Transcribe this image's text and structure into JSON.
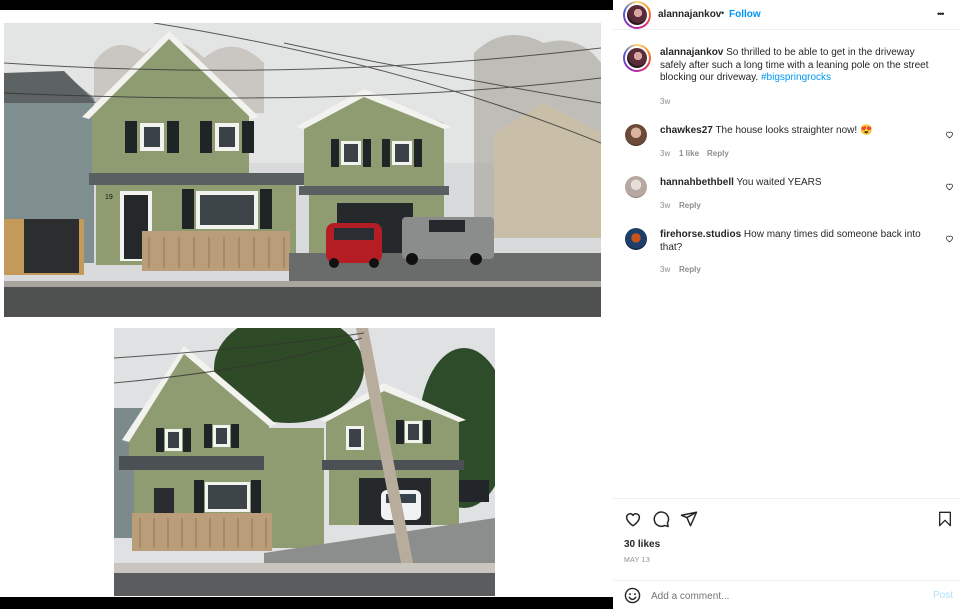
{
  "post": {
    "author": "alannajankov",
    "follow_label": "Follow",
    "separator": "•",
    "more_label": "•••",
    "caption_text": "So thrilled to be able to get in the driveway safely after such a long time with a leaning pole on the street blocking our driveway.",
    "hashtag": "#bigspringrocks",
    "caption_age": "3w",
    "likes": "30 likes",
    "date": "MAY 13",
    "add_comment_placeholder": "Add a comment...",
    "post_button": "Post",
    "house_number": "19"
  },
  "comments": [
    {
      "user": "chawkes27",
      "text": "The house looks straighter now! 😍",
      "age": "3w",
      "likes": "1 like",
      "reply": "Reply"
    },
    {
      "user": "hannahbethbell",
      "text": "You waited YEARS",
      "age": "3w",
      "likes": "",
      "reply": "Reply"
    },
    {
      "user": "firehorse.studios",
      "text": "How many times did someone back into that?",
      "age": "3w",
      "likes": "",
      "reply": "Reply"
    }
  ],
  "icons": {
    "like": "heart-icon",
    "comment": "comment-bubble-icon",
    "share": "paper-plane-icon",
    "save": "bookmark-icon",
    "emoji": "smiley-icon"
  },
  "colors": {
    "accent": "#0095f6",
    "text": "#262626",
    "muted": "#8e8e8e",
    "siding": "#8f9c72",
    "trim": "#f2f2ee"
  }
}
